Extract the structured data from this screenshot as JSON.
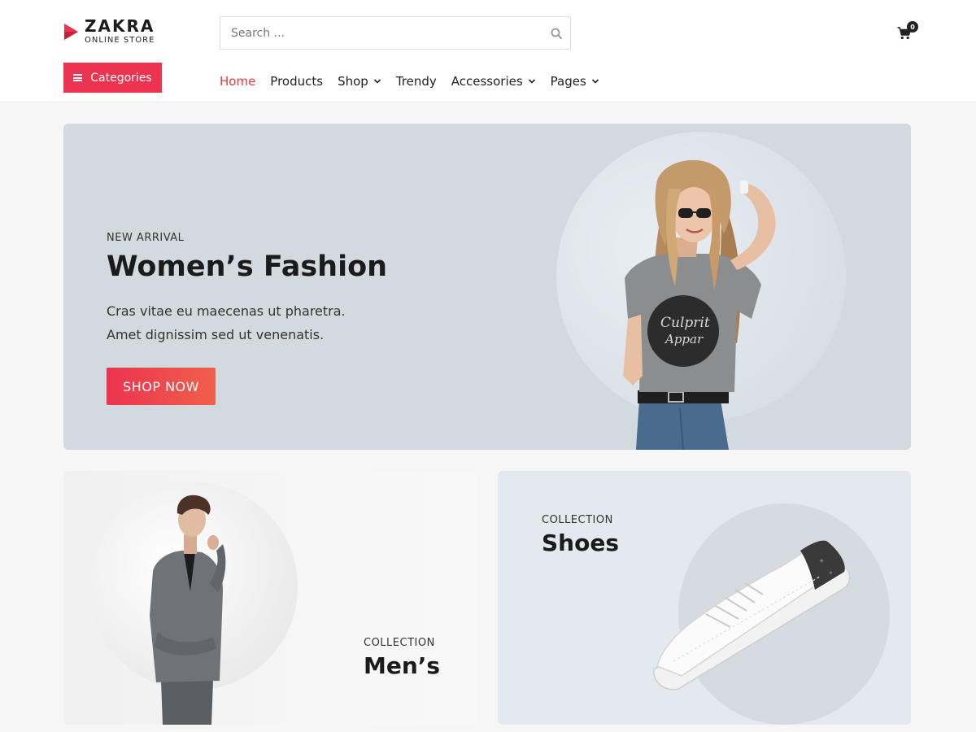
{
  "brand": {
    "name": "ZAKRA",
    "tagline": "ONLINE STORE",
    "accent": "#ec3350"
  },
  "search": {
    "placeholder": "Search ..."
  },
  "cart": {
    "count": "0"
  },
  "categories": {
    "label": "Categories"
  },
  "nav": {
    "items": [
      {
        "label": "Home",
        "active": true,
        "dropdown": false
      },
      {
        "label": "Products",
        "active": false,
        "dropdown": false
      },
      {
        "label": "Shop",
        "active": false,
        "dropdown": true
      },
      {
        "label": "Trendy",
        "active": false,
        "dropdown": false
      },
      {
        "label": "Accessories",
        "active": false,
        "dropdown": true
      },
      {
        "label": "Pages",
        "active": false,
        "dropdown": true
      }
    ]
  },
  "hero": {
    "eyebrow": "NEW ARRIVAL",
    "title": "Women’s Fashion",
    "desc_line1": "Cras vitae eu maecenas ut pharetra.",
    "desc_line2": "Amet dignissim sed ut venenatis.",
    "cta": "SHOP NOW",
    "shirt_text_1": "Culprit",
    "shirt_text_2": "Appar"
  },
  "collections": {
    "mens": {
      "eyebrow": "COLLECTION",
      "title": "Men’s"
    },
    "shoes": {
      "eyebrow": "COLLECTION",
      "title": "Shoes"
    }
  }
}
